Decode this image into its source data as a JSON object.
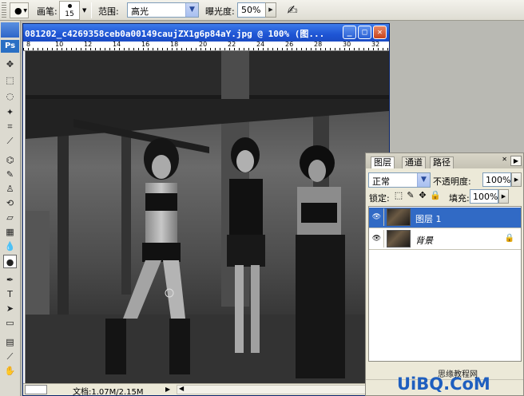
{
  "options_bar": {
    "brush_label": "画笔:",
    "brush_size": "15",
    "range_label": "范围:",
    "range_value": "高光",
    "exposure_label": "曝光度:",
    "exposure_value": "50%"
  },
  "toolbox": {
    "logo": "Ps",
    "tools": [
      "move-icon",
      "marquee-icon",
      "lasso-icon",
      "magic-wand-icon",
      "crop-icon",
      "slice-icon",
      "healing-brush-icon",
      "brush-icon",
      "clone-stamp-icon",
      "history-brush-icon",
      "eraser-icon",
      "gradient-icon",
      "blur-icon",
      "dodge-icon",
      "pen-icon",
      "type-icon",
      "path-selection-icon",
      "shape-icon",
      "notes-icon",
      "eyedropper-icon",
      "hand-icon"
    ]
  },
  "document": {
    "title": "081202_c4269358ceb0a00149caujZX1g6p84aY.jpg @ 100% (图...",
    "ruler_marks": [
      "8",
      "10",
      "12",
      "14",
      "16",
      "18",
      "20",
      "22",
      "24",
      "26",
      "28",
      "30",
      "32"
    ],
    "status": "文档:1.07M/2.15M"
  },
  "layers_panel": {
    "tabs": [
      "图层",
      "通道",
      "路径"
    ],
    "blend_mode": "正常",
    "opacity_label": "不透明度:",
    "opacity_value": "100%",
    "lock_label": "锁定:",
    "fill_label": "填充:",
    "fill_value": "100%",
    "layers": [
      {
        "name": "图层 1",
        "selected": true
      },
      {
        "name": "背景",
        "selected": false,
        "locked": true
      }
    ]
  },
  "watermark": {
    "line1": "思缘教程网",
    "logo": "UiBQ.CoM"
  },
  "colors": {
    "title_bar": "#1e55d4",
    "selected_layer": "#316ac5",
    "panel_bg": "#ece9d8"
  }
}
